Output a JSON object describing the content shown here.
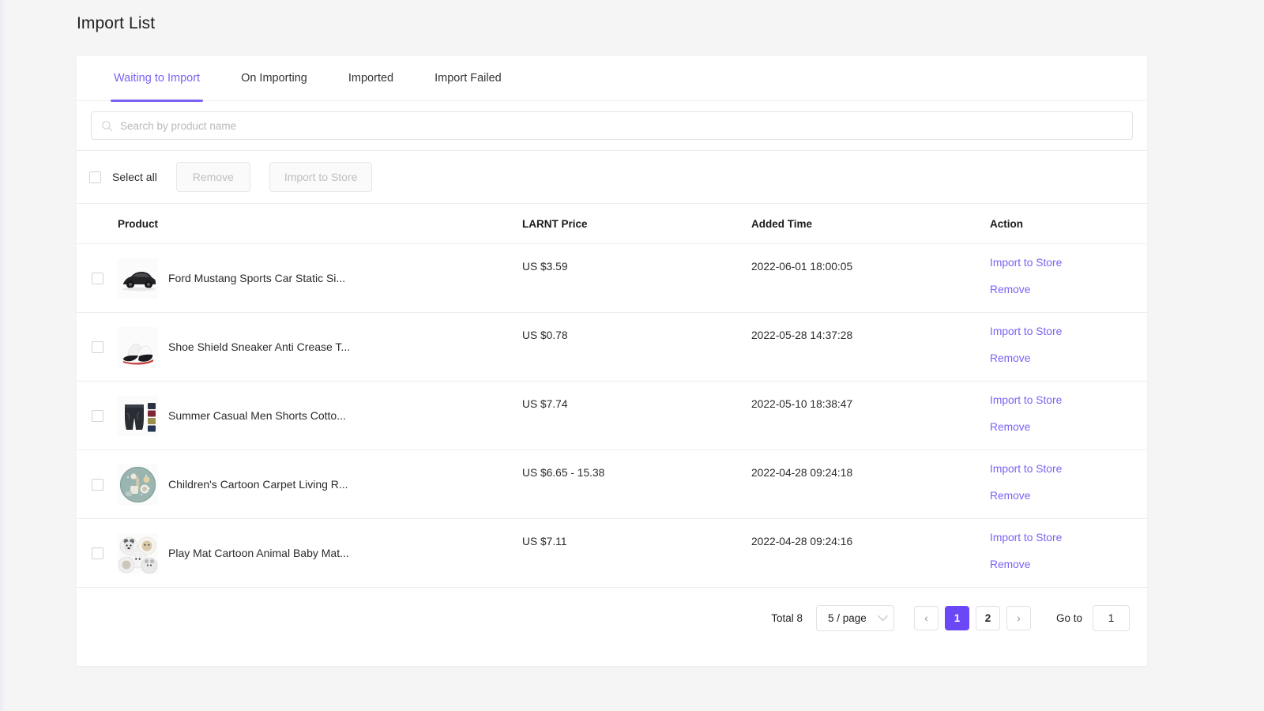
{
  "page": {
    "title": "Import List"
  },
  "tabs": [
    {
      "label": "Waiting to Import",
      "active": true
    },
    {
      "label": "On Importing",
      "active": false
    },
    {
      "label": "Imported",
      "active": false
    },
    {
      "label": "Import Failed",
      "active": false
    }
  ],
  "search": {
    "placeholder": "Search by product name",
    "value": "",
    "icon": "search-icon"
  },
  "bulk": {
    "select_all_label": "Select all",
    "remove_label": "Remove",
    "import_label": "Import to Store"
  },
  "table": {
    "columns": [
      "Product",
      "LARNT Price",
      "Added Time",
      "Action"
    ],
    "rows": [
      {
        "name": "Ford Mustang Sports Car Static Si...",
        "price": "US $3.59",
        "added_time": "2022-06-01 18:00:05",
        "thumb": "car-thumbnail",
        "actions": [
          "Import to Store",
          "Remove"
        ]
      },
      {
        "name": "Shoe Shield Sneaker Anti Crease T...",
        "price": "US $0.78",
        "added_time": "2022-05-28 14:37:28",
        "thumb": "sneaker-thumbnail",
        "actions": [
          "Import to Store",
          "Remove"
        ]
      },
      {
        "name": "Summer Casual Men Shorts Cotto...",
        "price": "US $7.74",
        "added_time": "2022-05-10 18:38:47",
        "thumb": "shorts-thumbnail",
        "actions": [
          "Import to Store",
          "Remove"
        ]
      },
      {
        "name": "Children's Cartoon Carpet Living R...",
        "price": "US $6.65 - 15.38",
        "added_time": "2022-04-28 09:24:18",
        "thumb": "carpet-thumbnail",
        "actions": [
          "Import to Store",
          "Remove"
        ]
      },
      {
        "name": "Play Mat Cartoon Animal Baby Mat...",
        "price": "US $7.11",
        "added_time": "2022-04-28 09:24:16",
        "thumb": "playmat-thumbnail",
        "actions": [
          "Import to Store",
          "Remove"
        ]
      }
    ]
  },
  "pagination": {
    "total_label": "Total 8",
    "page_size_label": "5 / page",
    "prev_label": "‹",
    "next_label": "›",
    "pages": [
      "1",
      "2"
    ],
    "current_page": "1",
    "goto_label": "Go to",
    "goto_value": "1"
  },
  "colors": {
    "accent": "#7b61f5",
    "accent_solid": "#6c47f5",
    "page_bg": "#f5f5f5",
    "card_bg": "#ffffff",
    "border": "#ededed",
    "text": "#2b2b2b",
    "muted": "#bfbfbf"
  }
}
